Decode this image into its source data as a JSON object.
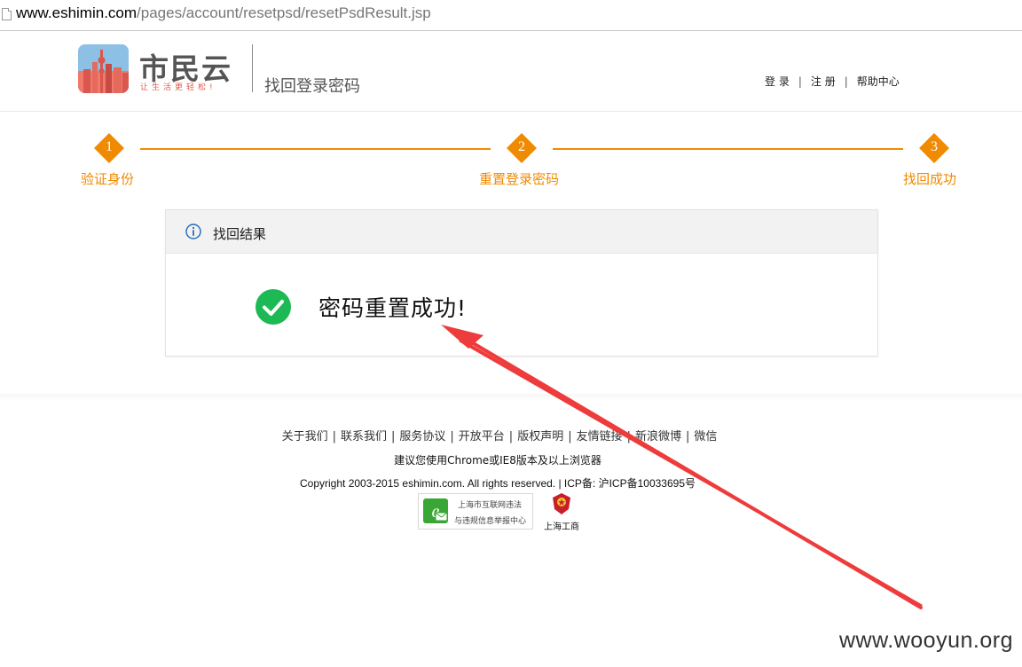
{
  "browser": {
    "url_domain": "www.eshimin.com",
    "url_path": "/pages/account/resetpsd/resetPsdResult.jsp"
  },
  "header": {
    "logo_name": "市民云",
    "logo_slogan": "让生活更轻松!",
    "page_title": "找回登录密码",
    "links": {
      "login": "登 录",
      "register": "注 册",
      "help": "帮助中心",
      "separator": "|"
    }
  },
  "steps": [
    {
      "number": "1",
      "label": "验证身份"
    },
    {
      "number": "2",
      "label": "重置登录密码"
    },
    {
      "number": "3",
      "label": "找回成功"
    }
  ],
  "result": {
    "panel_title": "找回结果",
    "message": "密码重置成功!"
  },
  "footer": {
    "links": [
      "关于我们",
      "联系我们",
      "服务协议",
      "开放平台",
      "版权声明",
      "友情链接",
      "新浪微博",
      "微信"
    ],
    "separator": "|",
    "browser_tip": "建议您使用Chrome或IE8版本及以上浏览器",
    "copyright": "Copyright 2003-2015 eshimin.com. All rights reserved. | ICP备: 沪ICP备10033695号",
    "badge_report_line1": "上海市互联网违法",
    "badge_report_line2": "与违规信息举报中心",
    "badge_gongshang": "上海工商"
  },
  "watermark": "www.wooyun.org",
  "colors": {
    "step_accent": "#f08a00",
    "success_green": "#1db954",
    "annotation_red": "#ee3b3b",
    "info_blue": "#2a6fb8"
  },
  "icons": {
    "info": "info-circle-icon",
    "success": "check-circle-icon",
    "report": "e-letter-icon",
    "emblem": "police-emblem-icon"
  }
}
